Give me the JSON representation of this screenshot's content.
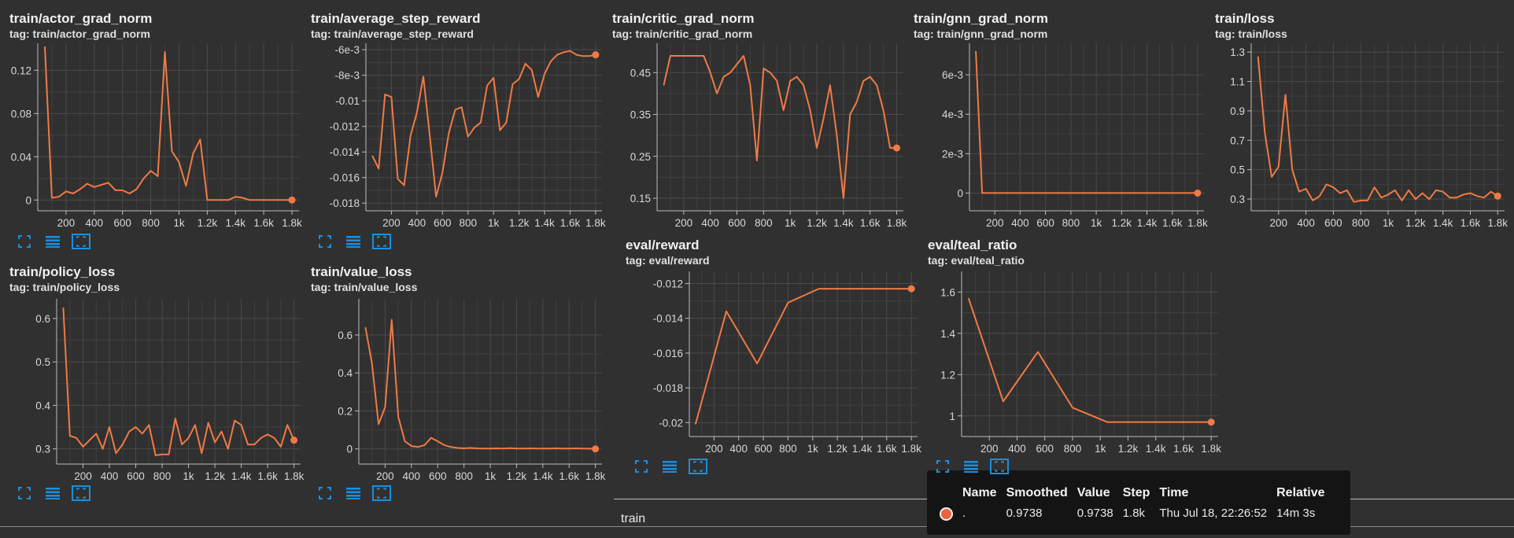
{
  "colors": {
    "line": "#f07a45",
    "grid": "#4a4a4a",
    "axis": "#bdbdbd",
    "background": "#303030",
    "accent": "#1a8fe0"
  },
  "toolbar_icons": [
    "fullscreen-icon",
    "data-table-icon",
    "fit-domain-icon"
  ],
  "chart_data": [
    {
      "id": "actor",
      "type": "line",
      "title": "train/actor_grad_norm",
      "tag": "tag: train/actor_grad_norm",
      "x_ticks": [
        "200",
        "400",
        "600",
        "800",
        "1k",
        "1.2k",
        "1.4k",
        "1.6k",
        "1.8k"
      ],
      "y_ticks": [
        "0",
        "0.04",
        "0.08",
        "0.12"
      ],
      "xlim": [
        0,
        1850
      ],
      "ylim": [
        -0.01,
        0.145
      ],
      "series": [
        {
          "x": [
            50,
            100,
            150,
            200,
            250,
            300,
            350,
            400,
            450,
            500,
            550,
            600,
            650,
            700,
            750,
            800,
            850,
            900,
            950,
            1000,
            1050,
            1100,
            1150,
            1200,
            1250,
            1300,
            1350,
            1400,
            1450,
            1500,
            1550,
            1600,
            1650,
            1700,
            1750,
            1800
          ],
          "y": [
            0.142,
            0.002,
            0.003,
            0.008,
            0.006,
            0.01,
            0.015,
            0.012,
            0.014,
            0.016,
            0.009,
            0.009,
            0.006,
            0.01,
            0.02,
            0.027,
            0.022,
            0.137,
            0.045,
            0.035,
            0.013,
            0.043,
            0.056,
            0.0,
            0.0,
            0.0,
            0.0,
            0.003,
            0.002,
            0.0,
            0.0,
            0.0,
            0.0,
            0.0,
            0.0,
            0.0
          ]
        }
      ],
      "end_marker": true
    },
    {
      "id": "reward",
      "type": "line",
      "title": "train/average_step_reward",
      "tag": "tag: train/average_step_reward",
      "x_ticks": [
        "200",
        "400",
        "600",
        "800",
        "1k",
        "1.2k",
        "1.4k",
        "1.6k",
        "1.8k"
      ],
      "y_ticks": [
        "-0.018",
        "-0.016",
        "-0.014",
        "-0.012",
        "-0.01",
        "-8e-3",
        "-6e-3"
      ],
      "xlim": [
        0,
        1850
      ],
      "ylim": [
        -0.0186,
        -0.0055
      ],
      "series": [
        {
          "x": [
            50,
            100,
            150,
            200,
            250,
            300,
            350,
            400,
            450,
            500,
            550,
            600,
            650,
            700,
            750,
            800,
            850,
            900,
            950,
            1000,
            1050,
            1100,
            1150,
            1200,
            1250,
            1300,
            1350,
            1400,
            1450,
            1500,
            1550,
            1600,
            1650,
            1700,
            1750,
            1800
          ],
          "y": [
            -0.0143,
            -0.0153,
            -0.0095,
            -0.0097,
            -0.0161,
            -0.0166,
            -0.0127,
            -0.0109,
            -0.0081,
            -0.0127,
            -0.0175,
            -0.0156,
            -0.0125,
            -0.0107,
            -0.0105,
            -0.0128,
            -0.0121,
            -0.0117,
            -0.0088,
            -0.0082,
            -0.0123,
            -0.0117,
            -0.0087,
            -0.0083,
            -0.0071,
            -0.0076,
            -0.0097,
            -0.0079,
            -0.0069,
            -0.0064,
            -0.0062,
            -0.0061,
            -0.0064,
            -0.0065,
            -0.0065,
            -0.0064
          ]
        }
      ],
      "end_marker": true
    },
    {
      "id": "critic",
      "type": "line",
      "title": "train/critic_grad_norm",
      "tag": "tag: train/critic_grad_norm",
      "x_ticks": [
        "200",
        "400",
        "600",
        "800",
        "1k",
        "1.2k",
        "1.4k",
        "1.6k",
        "1.8k"
      ],
      "y_ticks": [
        "0.15",
        "0.25",
        "0.35",
        "0.45"
      ],
      "xlim": [
        0,
        1850
      ],
      "ylim": [
        0.12,
        0.52
      ],
      "series": [
        {
          "x": [
            50,
            100,
            150,
            200,
            250,
            300,
            350,
            400,
            450,
            500,
            550,
            600,
            650,
            700,
            750,
            800,
            850,
            900,
            950,
            1000,
            1050,
            1100,
            1150,
            1200,
            1250,
            1300,
            1350,
            1400,
            1450,
            1500,
            1550,
            1600,
            1650,
            1700,
            1750,
            1800
          ],
          "y": [
            0.42,
            0.49,
            0.49,
            0.49,
            0.49,
            0.49,
            0.49,
            0.45,
            0.4,
            0.44,
            0.45,
            0.47,
            0.49,
            0.42,
            0.24,
            0.46,
            0.45,
            0.43,
            0.36,
            0.43,
            0.44,
            0.42,
            0.36,
            0.27,
            0.34,
            0.42,
            0.3,
            0.15,
            0.35,
            0.38,
            0.43,
            0.44,
            0.42,
            0.36,
            0.27,
            0.27
          ]
        }
      ],
      "end_marker": true
    },
    {
      "id": "gnn",
      "type": "line",
      "title": "train/gnn_grad_norm",
      "tag": "tag: train/gnn_grad_norm",
      "x_ticks": [
        "200",
        "400",
        "600",
        "800",
        "1k",
        "1.2k",
        "1.4k",
        "1.6k",
        "1.8k"
      ],
      "y_ticks": [
        "0",
        "2e-3",
        "4e-3",
        "6e-3"
      ],
      "xlim": [
        0,
        1850
      ],
      "ylim": [
        -0.0009,
        0.0076
      ],
      "series": [
        {
          "x": [
            50,
            100,
            150,
            200,
            400,
            600,
            800,
            1000,
            1200,
            1400,
            1600,
            1800
          ],
          "y": [
            0.0072,
            0.0,
            0.0,
            0.0,
            0.0,
            0.0,
            0.0,
            0.0,
            0.0,
            0.0,
            0.0,
            0.0
          ]
        }
      ],
      "end_marker": true
    },
    {
      "id": "loss",
      "type": "line",
      "title": "train/loss",
      "tag": "tag: train/loss",
      "x_ticks": [
        "200",
        "400",
        "600",
        "800",
        "1k",
        "1.2k",
        "1.4k",
        "1.6k",
        "1.8k"
      ],
      "y_ticks": [
        "0.3",
        "0.5",
        "0.7",
        "0.9",
        "1.1",
        "1.3"
      ],
      "xlim": [
        0,
        1850
      ],
      "ylim": [
        0.22,
        1.36
      ],
      "series": [
        {
          "x": [
            50,
            100,
            150,
            200,
            250,
            300,
            350,
            400,
            450,
            500,
            550,
            600,
            650,
            700,
            750,
            800,
            850,
            900,
            950,
            1000,
            1050,
            1100,
            1150,
            1200,
            1250,
            1300,
            1350,
            1400,
            1450,
            1500,
            1550,
            1600,
            1650,
            1700,
            1750,
            1800
          ],
          "y": [
            1.27,
            0.75,
            0.45,
            0.52,
            1.01,
            0.5,
            0.35,
            0.37,
            0.29,
            0.32,
            0.4,
            0.38,
            0.34,
            0.36,
            0.28,
            0.29,
            0.29,
            0.38,
            0.31,
            0.33,
            0.36,
            0.29,
            0.36,
            0.3,
            0.34,
            0.3,
            0.36,
            0.35,
            0.31,
            0.31,
            0.33,
            0.34,
            0.32,
            0.31,
            0.35,
            0.32
          ]
        }
      ],
      "end_marker": true
    },
    {
      "id": "policy",
      "type": "line",
      "title": "train/policy_loss",
      "tag": "tag: train/policy_loss",
      "x_ticks": [
        "200",
        "400",
        "600",
        "800",
        "1k",
        "1.2k",
        "1.4k",
        "1.6k",
        "1.8k"
      ],
      "y_ticks": [
        "0.3",
        "0.4",
        "0.5",
        "0.6"
      ],
      "xlim": [
        0,
        1850
      ],
      "ylim": [
        0.265,
        0.645
      ],
      "series": [
        {
          "x": [
            50,
            100,
            150,
            200,
            250,
            300,
            350,
            400,
            450,
            500,
            550,
            600,
            650,
            700,
            750,
            800,
            850,
            900,
            950,
            1000,
            1050,
            1100,
            1150,
            1200,
            1250,
            1300,
            1350,
            1400,
            1450,
            1500,
            1550,
            1600,
            1650,
            1700,
            1750,
            1800
          ],
          "y": [
            0.625,
            0.33,
            0.325,
            0.305,
            0.32,
            0.335,
            0.3,
            0.35,
            0.29,
            0.31,
            0.34,
            0.35,
            0.335,
            0.355,
            0.285,
            0.287,
            0.287,
            0.37,
            0.31,
            0.325,
            0.355,
            0.29,
            0.36,
            0.315,
            0.34,
            0.3,
            0.365,
            0.355,
            0.31,
            0.31,
            0.325,
            0.333,
            0.325,
            0.305,
            0.355,
            0.32
          ]
        }
      ],
      "end_marker": true
    },
    {
      "id": "value",
      "type": "line",
      "title": "train/value_loss",
      "tag": "tag: train/value_loss",
      "x_ticks": [
        "200",
        "400",
        "600",
        "800",
        "1k",
        "1.2k",
        "1.4k",
        "1.6k",
        "1.8k"
      ],
      "y_ticks": [
        "0",
        "0.2",
        "0.4",
        "0.6"
      ],
      "xlim": [
        0,
        1850
      ],
      "ylim": [
        -0.08,
        0.79
      ],
      "series": [
        {
          "x": [
            50,
            100,
            150,
            200,
            250,
            300,
            350,
            400,
            450,
            500,
            550,
            600,
            650,
            700,
            750,
            800,
            850,
            900,
            950,
            1000,
            1050,
            1100,
            1150,
            1200,
            1250,
            1300,
            1350,
            1400,
            1450,
            1500,
            1550,
            1600,
            1650,
            1700,
            1750,
            1800
          ],
          "y": [
            0.64,
            0.45,
            0.13,
            0.22,
            0.68,
            0.17,
            0.04,
            0.015,
            0.01,
            0.02,
            0.058,
            0.04,
            0.02,
            0.01,
            0.005,
            0.003,
            0.005,
            0.003,
            0.002,
            0.002,
            0.003,
            0.002,
            0.004,
            0.002,
            0.002,
            0.003,
            0.002,
            0.002,
            0.002,
            0.003,
            0.002,
            0.002,
            0.003,
            0.002,
            0.001,
            0.0
          ]
        }
      ],
      "end_marker": true
    },
    {
      "id": "eval_reward",
      "type": "line",
      "title": "eval/reward",
      "tag": "tag: eval/reward",
      "x_ticks": [
        "200",
        "400",
        "600",
        "800",
        "1k",
        "1.2k",
        "1.4k",
        "1.6k",
        "1.8k"
      ],
      "y_ticks": [
        "-0.02",
        "-0.018",
        "-0.016",
        "-0.014",
        "-0.012"
      ],
      "xlim": [
        0,
        1850
      ],
      "ylim": [
        -0.0208,
        -0.0113
      ],
      "series": [
        {
          "x": [
            50,
            300,
            550,
            800,
            1050,
            1300,
            1550,
            1800
          ],
          "y": [
            -0.0201,
            -0.0136,
            -0.0166,
            -0.0131,
            -0.0123,
            -0.0123,
            -0.0123,
            -0.0123
          ]
        }
      ],
      "end_marker": true
    },
    {
      "id": "teal",
      "type": "line",
      "title": "eval/teal_ratio",
      "tag": "tag: eval/teal_ratio",
      "x_ticks": [
        "200",
        "400",
        "600",
        "800",
        "1k",
        "1.2k",
        "1.4k",
        "1.6k",
        "1.8k"
      ],
      "y_ticks": [
        "1",
        "1.2",
        "1.4",
        "1.6"
      ],
      "xlim": [
        0,
        1850
      ],
      "ylim": [
        0.9,
        1.7
      ],
      "series": [
        {
          "x": [
            50,
            300,
            550,
            800,
            1050,
            1300,
            1550,
            1800
          ],
          "y": [
            1.57,
            1.07,
            1.31,
            1.04,
            0.97,
            0.97,
            0.97,
            0.97
          ]
        }
      ],
      "end_marker": true
    }
  ],
  "run_label": "train",
  "tooltip": {
    "headers": [
      "Name",
      "Smoothed",
      "Value",
      "Step",
      "Time",
      "Relative"
    ],
    "row": {
      "name": ".",
      "smoothed": "0.9738",
      "value": "0.9738",
      "step": "1.8k",
      "time": "Thu Jul 18, 22:26:52",
      "relative": "14m 3s"
    }
  }
}
